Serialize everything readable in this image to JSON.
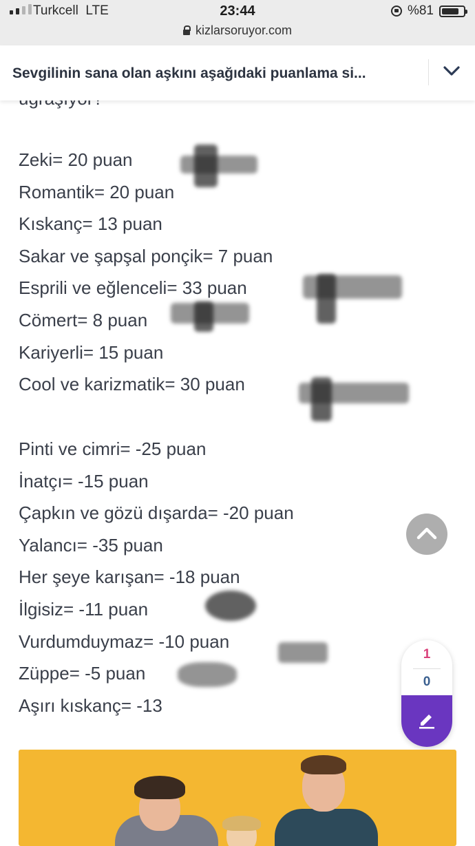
{
  "status_bar": {
    "carrier": "Turkcell",
    "network": "LTE",
    "time": "23:44",
    "battery": "%81",
    "battery_level": 0.81,
    "signal_bars": 2,
    "signal_total": 4
  },
  "browser": {
    "url": "kizlarsoruyor.com"
  },
  "header": {
    "title": "Sevgilinin sana olan aşkını aşağıdaki puanlama si...",
    "chevron_icon": "chevron-down-icon"
  },
  "content": {
    "cut_off_line": "uğraşıyor?",
    "positive_items": [
      "Zeki= 20 puan",
      "Romantik= 20 puan",
      "Kıskanç= 13 puan",
      "Sakar ve şapşal ponçik= 7 puan",
      "Esprili ve eğlenceli= 33 puan",
      "Cömert= 8 puan",
      "Kariyerli= 15 puan",
      "Cool ve karizmatik= 30 puan"
    ],
    "negative_items": [
      "Pinti ve cimri= -25 puan",
      "İnatçı= -15 puan",
      "Çapkın ve gözü dışarda= -20 puan",
      "Yalancı= -35 puan",
      "Her şeye karışan= -18 puan",
      "İlgisiz= -11 puan",
      "Vurdumduymaz= -10 puan",
      "Züppe= -5 puan",
      "Aşırı kıskanç= -13"
    ]
  },
  "vote_widget": {
    "up_count": "1",
    "down_count": "0",
    "edit_icon": "pencil-icon",
    "accent": "#6a36c0"
  },
  "scroll_top_icon": "chevron-up-icon",
  "banner_color": "#f4b731"
}
